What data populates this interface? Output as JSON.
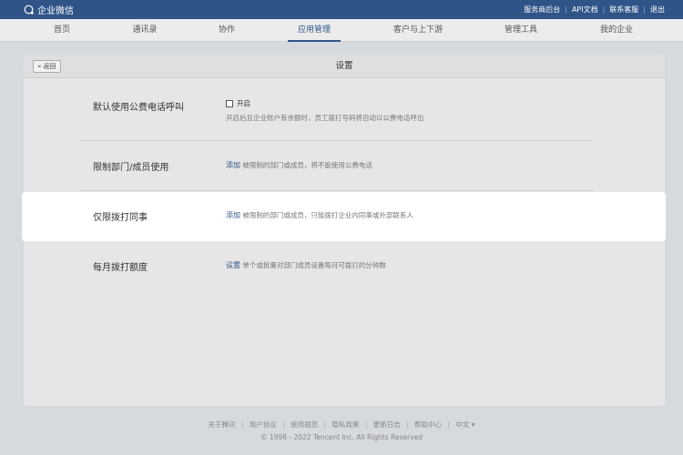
{
  "topbar": {
    "logo_text": "企业微信",
    "links": [
      "服务商后台",
      "API文档",
      "联系客服",
      "退出"
    ],
    "separator": "|"
  },
  "nav": {
    "items": [
      "首页",
      "通讯录",
      "协作",
      "应用管理",
      "客户与上下游",
      "管理工具",
      "我的企业"
    ],
    "active_index": 3
  },
  "card": {
    "back_label": "« 返回",
    "title": "设置"
  },
  "settings": {
    "row1": {
      "label": "默认使用公费电话呼叫",
      "checkbox_label": "开启",
      "checked": false,
      "desc": "开启后且企业账户有余额时，员工拨打号码将自动以公费电话呼出"
    },
    "row2": {
      "label": "限制部门/成员使用",
      "link": "添加",
      "desc": "被限制的部门或成员，将不能使用公费电话"
    },
    "row3": {
      "label": "仅限拨打同事",
      "link": "添加",
      "desc": "被限制的部门或成员，只能拨打企业内同事或外部联系人"
    },
    "row4": {
      "label": "每月拨打额度",
      "link": "设置",
      "desc": "单个或批量对部门成员设置每月可拨打的分钟数"
    }
  },
  "footer": {
    "links": [
      "关于腾讯",
      "用户协议",
      "使用规范",
      "隐私政策",
      "更新日志",
      "帮助中心",
      "中文 ▾"
    ],
    "separator": "|",
    "copyright": "© 1998 - 2022 Tencent Inc. All Rights Reserved"
  }
}
